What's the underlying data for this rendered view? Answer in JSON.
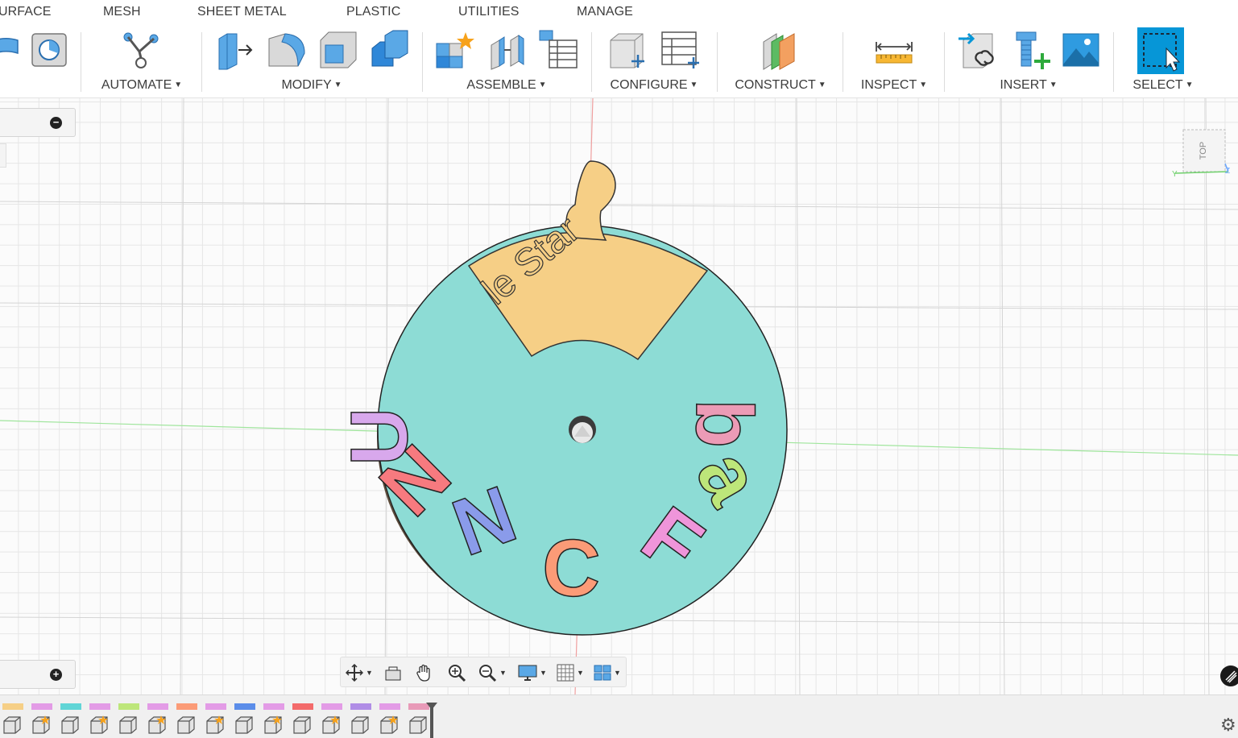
{
  "tabs": [
    "URFACE",
    "MESH",
    "SHEET METAL",
    "PLASTIC",
    "UTILITIES",
    "MANAGE"
  ],
  "groups": {
    "automate": "AUTOMATE",
    "modify": "MODIFY",
    "assemble": "ASSEMBLE",
    "configure": "CONFIGURE",
    "construct": "CONSTRUCT",
    "inspect": "INSPECT",
    "insert": "INSERT",
    "select": "SELECT"
  },
  "viewcube": {
    "face_label": "TOP"
  },
  "model": {
    "inner_text": "le Star",
    "outer_letters": [
      "U",
      "N",
      "N",
      "C",
      "F",
      "a",
      "b"
    ]
  },
  "colors": {
    "wheel": "#8ddcd5",
    "segment": "#f6cf86",
    "accent_blue": "#0696d7",
    "letter_u": "#d8a8ec",
    "letter_n1": "#f77a7f",
    "letter_n2": "#8a9bea",
    "letter_c": "#fb9b77",
    "letter_f": "#ef95da",
    "letter_a": "#bde67a",
    "letter_b": "#ec9bb6"
  },
  "timeline": {
    "bar_colors": [
      "#f6cf86",
      "#e39be6",
      "#60d5d6",
      "#e39be6",
      "#bde67a",
      "#e39be6",
      "#fb9b77",
      "#e39be6",
      "#5b8de9",
      "#e39be6",
      "#f36a6a",
      "#e39be6",
      "#b08de6",
      "#e39be6",
      "#e89ab8"
    ]
  }
}
